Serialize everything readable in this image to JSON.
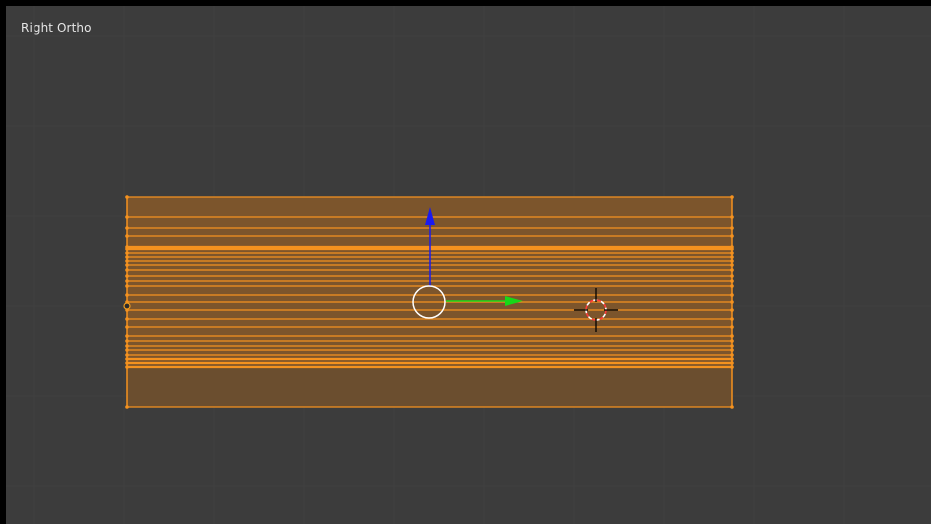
{
  "viewport": {
    "view_label": "Right Ortho",
    "background_color": "#3c3c3c",
    "grid_color": "#404040"
  },
  "mesh": {
    "name": "selected-mesh-object",
    "selected": true,
    "edge_color": "#f5921f",
    "face_color": "#8a5a28"
  },
  "gizmo": {
    "up_axis_color": "#1a1af0",
    "right_axis_color": "#18d818",
    "center_color": "#ffffff"
  },
  "cursor_3d": {
    "ring_color_a": "#ff3a3a",
    "ring_color_b": "#ffffff",
    "crosshair_color": "#000000"
  }
}
